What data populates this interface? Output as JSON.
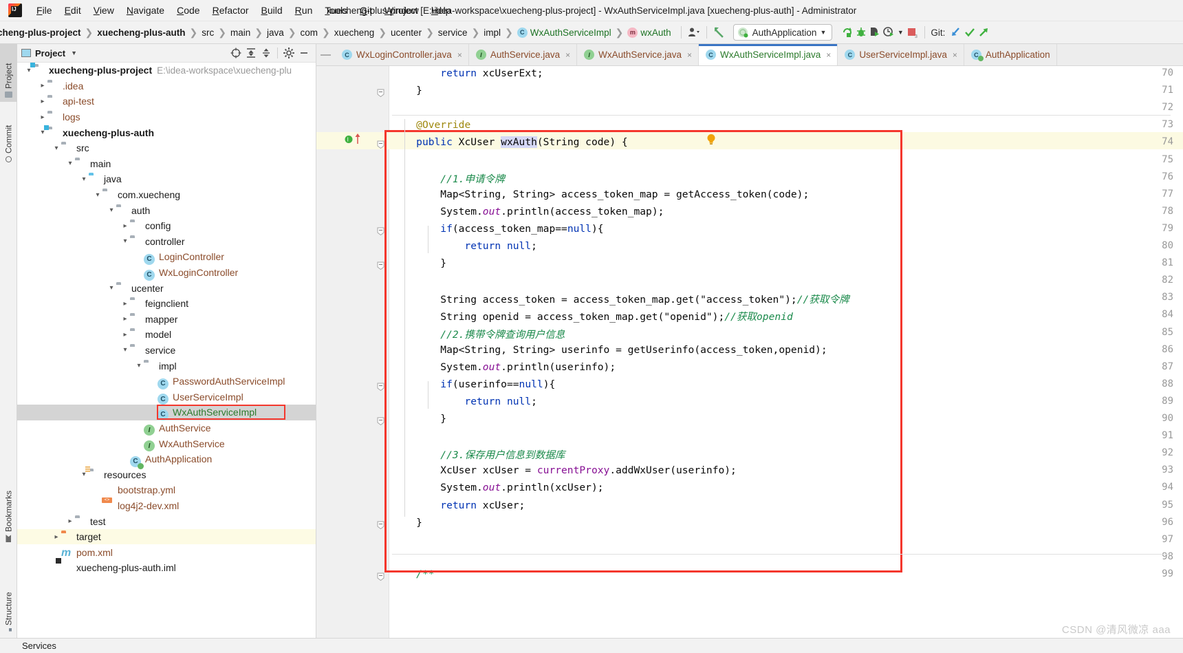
{
  "window": {
    "title": "xuecheng-plus-project [E:\\idea-workspace\\xuecheng-plus-project] - WxAuthServiceImpl.java [xuecheng-plus-auth] - Administrator",
    "app_icon": "intellij-idea-logo"
  },
  "menubar": {
    "items": [
      {
        "label": "File",
        "mnemonic": "F"
      },
      {
        "label": "Edit",
        "mnemonic": "E"
      },
      {
        "label": "View",
        "mnemonic": "V"
      },
      {
        "label": "Navigate",
        "mnemonic": "N"
      },
      {
        "label": "Code",
        "mnemonic": "C"
      },
      {
        "label": "Refactor",
        "mnemonic": "R"
      },
      {
        "label": "Build",
        "mnemonic": "B"
      },
      {
        "label": "Run",
        "mnemonic": "R"
      },
      {
        "label": "Tools",
        "mnemonic": "T"
      },
      {
        "label": "Git",
        "mnemonic": "G"
      },
      {
        "label": "Window",
        "mnemonic": "W"
      },
      {
        "label": "Help",
        "mnemonic": "H"
      }
    ]
  },
  "navbar": {
    "crumbs": [
      {
        "label": "cheng-plus-project",
        "bold": true,
        "icon": null
      },
      {
        "label": "xuecheng-plus-auth",
        "bold": true,
        "icon": null
      },
      {
        "label": "src",
        "bold": false,
        "icon": null
      },
      {
        "label": "main",
        "bold": false,
        "icon": null
      },
      {
        "label": "java",
        "bold": false,
        "icon": null
      },
      {
        "label": "com",
        "bold": false,
        "icon": null
      },
      {
        "label": "xuecheng",
        "bold": false,
        "icon": null
      },
      {
        "label": "ucenter",
        "bold": false,
        "icon": null
      },
      {
        "label": "service",
        "bold": false,
        "icon": null
      },
      {
        "label": "impl",
        "bold": false,
        "icon": null
      },
      {
        "label": "WxAuthServiceImpl",
        "bold": false,
        "icon": "class-icon"
      },
      {
        "label": "wxAuth",
        "bold": false,
        "icon": "method-icon"
      }
    ],
    "run_config": "AuthApplication",
    "git_label": "Git:",
    "icons": [
      "user-settings-icon",
      "back-arrow-icon",
      "rerun-icon",
      "debug-icon",
      "run-with-coverage-icon",
      "profiler-icon",
      "stop-icon",
      "git-update-icon",
      "git-commit-icon",
      "git-push-icon"
    ]
  },
  "tool_strip": {
    "left_tabs": [
      {
        "label": "Project",
        "active": true,
        "icon": "project-icon"
      },
      {
        "label": "Commit",
        "active": false,
        "icon": "commit-icon"
      },
      {
        "label": "Bookmarks",
        "active": false,
        "icon": "bookmark-icon"
      },
      {
        "label": "Structure",
        "active": false,
        "icon": "structure-icon"
      }
    ]
  },
  "project_panel": {
    "title": "Project",
    "header_icons": [
      "locate-icon",
      "expand-all-icon",
      "collapse-all-icon",
      "gear-icon",
      "hide-icon"
    ],
    "tree": [
      {
        "depth": 0,
        "arrow": "down",
        "icon": "module-folder",
        "label": "xuecheng-plus-project",
        "bold": true,
        "color": "dark",
        "path": "E:\\idea-workspace\\xuecheng-plu"
      },
      {
        "depth": 1,
        "arrow": "right",
        "icon": "folder",
        "label": ".idea",
        "color": "brown"
      },
      {
        "depth": 1,
        "arrow": "right",
        "icon": "folder",
        "label": "api-test",
        "color": "brown"
      },
      {
        "depth": 1,
        "arrow": "right",
        "icon": "folder",
        "label": "logs",
        "color": "brown"
      },
      {
        "depth": 1,
        "arrow": "down",
        "icon": "module-folder",
        "label": "xuecheng-plus-auth",
        "bold": true,
        "color": "dark"
      },
      {
        "depth": 2,
        "arrow": "down",
        "icon": "folder",
        "label": "src",
        "color": "dark"
      },
      {
        "depth": 3,
        "arrow": "down",
        "icon": "folder",
        "label": "main",
        "color": "dark"
      },
      {
        "depth": 4,
        "arrow": "down",
        "icon": "folder-source",
        "label": "java",
        "color": "dark"
      },
      {
        "depth": 5,
        "arrow": "down",
        "icon": "package",
        "label": "com.xuecheng",
        "color": "dark"
      },
      {
        "depth": 6,
        "arrow": "down",
        "icon": "package",
        "label": "auth",
        "color": "dark"
      },
      {
        "depth": 7,
        "arrow": "right",
        "icon": "package",
        "label": "config",
        "color": "dark"
      },
      {
        "depth": 7,
        "arrow": "down",
        "icon": "package",
        "label": "controller",
        "color": "dark"
      },
      {
        "depth": 8,
        "arrow": "none",
        "icon": "class",
        "label": "LoginController",
        "color": "brown"
      },
      {
        "depth": 8,
        "arrow": "none",
        "icon": "class",
        "label": "WxLoginController",
        "color": "brown"
      },
      {
        "depth": 6,
        "arrow": "down",
        "icon": "package",
        "label": "ucenter",
        "color": "dark"
      },
      {
        "depth": 7,
        "arrow": "right",
        "icon": "package",
        "label": "feignclient",
        "color": "dark"
      },
      {
        "depth": 7,
        "arrow": "right",
        "icon": "package",
        "label": "mapper",
        "color": "dark"
      },
      {
        "depth": 7,
        "arrow": "right",
        "icon": "package",
        "label": "model",
        "color": "dark"
      },
      {
        "depth": 7,
        "arrow": "down",
        "icon": "package",
        "label": "service",
        "color": "dark"
      },
      {
        "depth": 8,
        "arrow": "down",
        "icon": "package",
        "label": "impl",
        "color": "dark"
      },
      {
        "depth": 9,
        "arrow": "none",
        "icon": "class",
        "label": "PasswordAuthServiceImpl",
        "color": "brown"
      },
      {
        "depth": 9,
        "arrow": "none",
        "icon": "class",
        "label": "UserServiceImpl",
        "color": "brown"
      },
      {
        "depth": 9,
        "arrow": "none",
        "icon": "class",
        "label": "WxAuthServiceImpl",
        "color": "green",
        "selected": true,
        "highlight_box": true
      },
      {
        "depth": 8,
        "arrow": "none",
        "icon": "interface",
        "label": "AuthService",
        "color": "brown"
      },
      {
        "depth": 8,
        "arrow": "none",
        "icon": "interface",
        "label": "WxAuthService",
        "color": "brown"
      },
      {
        "depth": 7,
        "arrow": "none",
        "icon": "spring-app",
        "label": "AuthApplication",
        "color": "brown"
      },
      {
        "depth": 4,
        "arrow": "down",
        "icon": "folder-resources",
        "label": "resources",
        "color": "dark"
      },
      {
        "depth": 5,
        "arrow": "none",
        "icon": "yaml",
        "label": "bootstrap.yml",
        "color": "brown"
      },
      {
        "depth": 5,
        "arrow": "none",
        "icon": "xml",
        "label": "log4j2-dev.xml",
        "color": "brown"
      },
      {
        "depth": 3,
        "arrow": "right",
        "icon": "folder",
        "label": "test",
        "color": "dark"
      },
      {
        "depth": 2,
        "arrow": "right",
        "icon": "folder-target",
        "label": "target",
        "color": "dark",
        "row_highlight": true
      },
      {
        "depth": 2,
        "arrow": "none",
        "icon": "maven",
        "label": "pom.xml",
        "color": "brown"
      },
      {
        "depth": 2,
        "arrow": "none",
        "icon": "iml",
        "label": "xuecheng-plus-auth.iml",
        "color": "dark"
      }
    ]
  },
  "editor": {
    "tabs": [
      {
        "label": "WxLoginController.java",
        "icon": "class-icon",
        "color": "brown",
        "active": false,
        "closable": true
      },
      {
        "label": "AuthService.java",
        "icon": "interface-icon",
        "color": "brown",
        "active": false,
        "closable": true
      },
      {
        "label": "WxAuthService.java",
        "icon": "interface-icon",
        "color": "brown",
        "active": false,
        "closable": true
      },
      {
        "label": "WxAuthServiceImpl.java",
        "icon": "class-icon",
        "color": "green",
        "active": true,
        "closable": true
      },
      {
        "label": "UserServiceImpl.java",
        "icon": "class-icon",
        "color": "brown",
        "active": false,
        "closable": true
      },
      {
        "label": "AuthApplication",
        "icon": "spring-app-icon",
        "color": "brown",
        "active": false,
        "closable": false
      }
    ],
    "first_line_number": 70,
    "last_line_number": 99,
    "current_line": 74,
    "caret_token": "wxAuth",
    "gutter_markers": [
      {
        "line": 74,
        "marker": "implementing-method-icon"
      },
      {
        "line": 74,
        "marker": "intention-bulb-icon"
      }
    ],
    "lines": [
      {
        "n": 70,
        "text": "        return xcUserExt;"
      },
      {
        "n": 71,
        "text": "    }"
      },
      {
        "n": 72,
        "text": ""
      },
      {
        "n": 73,
        "text": "    @Override"
      },
      {
        "n": 74,
        "text": "    public XcUser wxAuth(String code) {"
      },
      {
        "n": 75,
        "text": ""
      },
      {
        "n": 76,
        "text": "        //1.申请令牌"
      },
      {
        "n": 77,
        "text": "        Map<String, String> access_token_map = getAccess_token(code);"
      },
      {
        "n": 78,
        "text": "        System.out.println(access_token_map);"
      },
      {
        "n": 79,
        "text": "        if(access_token_map==null){"
      },
      {
        "n": 80,
        "text": "            return null;"
      },
      {
        "n": 81,
        "text": "        }"
      },
      {
        "n": 82,
        "text": ""
      },
      {
        "n": 83,
        "text": "        String access_token = access_token_map.get(\"access_token\");//获取令牌"
      },
      {
        "n": 84,
        "text": "        String openid = access_token_map.get(\"openid\");//获取openid"
      },
      {
        "n": 85,
        "text": "        //2.携带令牌查询用户信息"
      },
      {
        "n": 86,
        "text": "        Map<String, String> userinfo = getUserinfo(access_token,openid);"
      },
      {
        "n": 87,
        "text": "        System.out.println(userinfo);"
      },
      {
        "n": 88,
        "text": "        if(userinfo==null){"
      },
      {
        "n": 89,
        "text": "            return null;"
      },
      {
        "n": 90,
        "text": "        }"
      },
      {
        "n": 91,
        "text": ""
      },
      {
        "n": 92,
        "text": "        //3.保存用户信息到数据库"
      },
      {
        "n": 93,
        "text": "        XcUser xcUser = currentProxy.addWxUser(userinfo);"
      },
      {
        "n": 94,
        "text": "        System.out.println(xcUser);"
      },
      {
        "n": 95,
        "text": "        return xcUser;"
      },
      {
        "n": 96,
        "text": "    }"
      },
      {
        "n": 97,
        "text": ""
      },
      {
        "n": 98,
        "text": ""
      },
      {
        "n": 99,
        "text": "    /**"
      }
    ]
  },
  "statusbar": {
    "services_label": "Services"
  },
  "watermark": {
    "text": "CSDN @清风微凉 aaa"
  },
  "colors": {
    "accent": "#3a75c4",
    "annotation_box": "#f4372d",
    "keyword": "#0033b3",
    "string": "#067d17",
    "comment_cn": "#1b8a4b",
    "static_field": "#871094",
    "annotation": "#9e880d",
    "selection": "#d4d4d4",
    "current_line": "#fcfae2"
  }
}
